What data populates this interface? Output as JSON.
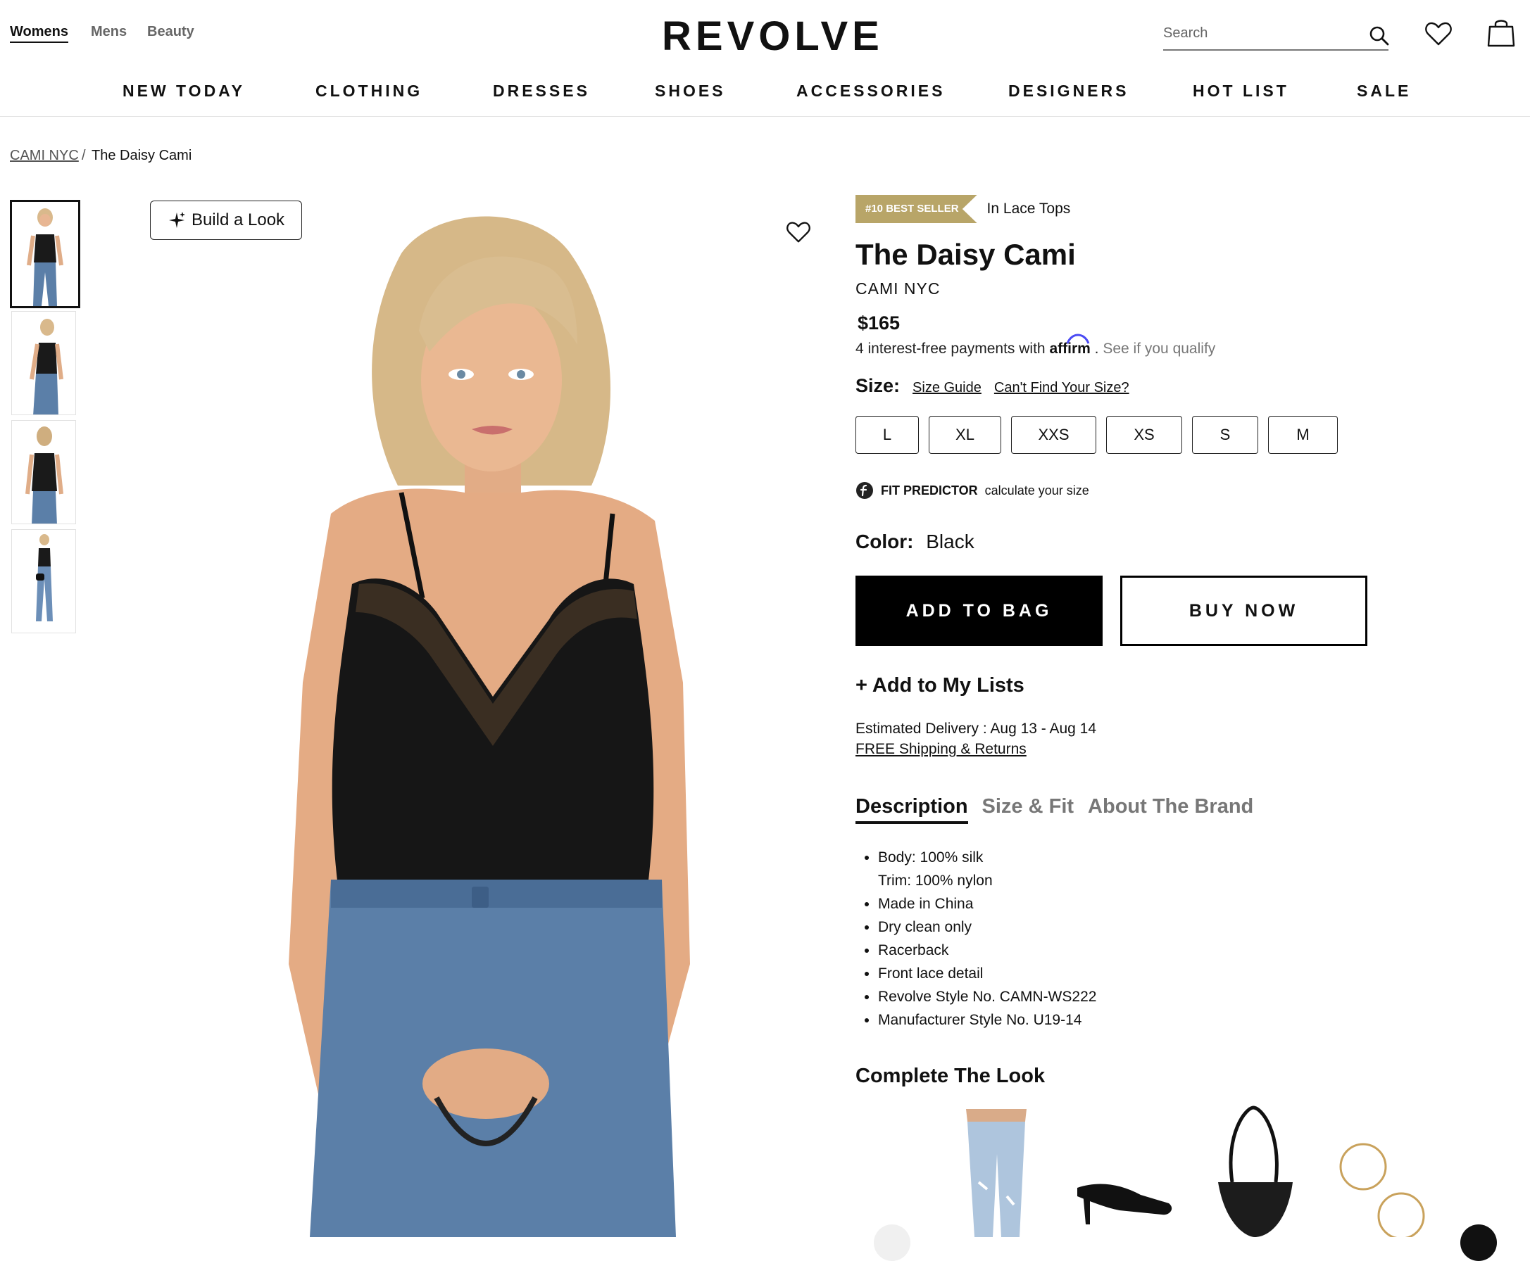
{
  "header": {
    "departments": [
      {
        "label": "Womens",
        "active": true
      },
      {
        "label": "Mens",
        "active": false
      },
      {
        "label": "Beauty",
        "active": false
      }
    ],
    "logo": "REVOLVE",
    "search_placeholder": "Search",
    "icons": [
      "search-icon",
      "heart-icon",
      "shopping-bag-icon"
    ]
  },
  "nav": [
    "NEW TODAY",
    "CLOTHING",
    "DRESSES",
    "SHOES",
    "ACCESSORIES",
    "DESIGNERS",
    "HOT LIST",
    "SALE"
  ],
  "breadcrumb": {
    "brand": "CAMI NYC",
    "separator": "/",
    "current": "The Daisy Cami"
  },
  "gallery": {
    "build_look_label": "Build a Look",
    "thumbnail_count": 4,
    "active_thumbnail": 1
  },
  "product": {
    "badge": "#10 BEST SELLER",
    "badge_context": "In Lace Tops",
    "title": "The Daisy Cami",
    "brand": "CAMI NYC",
    "price": "$165",
    "affirm_prefix": "4 interest-free payments with",
    "affirm_brand": "affirm",
    "affirm_link": "See if you qualify",
    "size_label": "Size:",
    "size_guide": "Size Guide",
    "cant_find_size": "Can't Find Your Size?",
    "sizes": [
      "L",
      "XL",
      "XXS",
      "XS",
      "S",
      "M"
    ],
    "fit_predictor_label": "FIT PREDICTOR",
    "fit_predictor_sub": "calculate your size",
    "color_label": "Color:",
    "color_value": "Black",
    "add_to_bag": "ADD TO BAG",
    "buy_now": "BUY NOW",
    "add_to_lists": "+ Add to My Lists",
    "delivery": "Estimated Delivery : Aug 13 - Aug 14",
    "shipping": "FREE Shipping & Returns"
  },
  "tabs": [
    {
      "label": "Description",
      "active": true
    },
    {
      "label": "Size & Fit",
      "active": false
    },
    {
      "label": "About The Brand",
      "active": false
    }
  ],
  "description": [
    [
      "Body: 100% silk",
      "Trim: 100% nylon"
    ],
    [
      "Made in China"
    ],
    [
      "Dry clean only"
    ],
    [
      "Racerback"
    ],
    [
      "Front lace detail"
    ],
    [
      "Revolve Style No. CAMN-WS222"
    ],
    [
      "Manufacturer Style No. U19-14"
    ]
  ],
  "complete_the_look": {
    "heading": "Complete The Look",
    "items": [
      "jeans",
      "heeled-mule",
      "shoulder-bag",
      "hoop-earrings"
    ]
  },
  "colors": {
    "badge": "#b8a568",
    "affirm": "#4a4af4",
    "accent_black": "#000000"
  }
}
